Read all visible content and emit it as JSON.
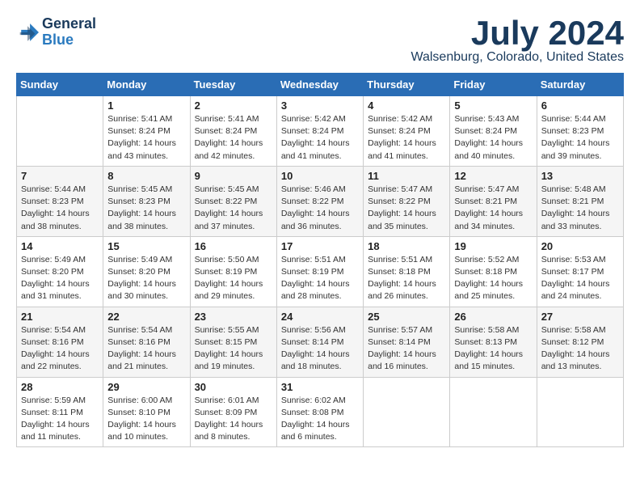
{
  "logo": {
    "line1": "General",
    "line2": "Blue"
  },
  "title": "July 2024",
  "location": "Walsenburg, Colorado, United States",
  "weekdays": [
    "Sunday",
    "Monday",
    "Tuesday",
    "Wednesday",
    "Thursday",
    "Friday",
    "Saturday"
  ],
  "weeks": [
    [
      {
        "day": null,
        "sunrise": null,
        "sunset": null,
        "daylight": null
      },
      {
        "day": "1",
        "sunrise": "Sunrise: 5:41 AM",
        "sunset": "Sunset: 8:24 PM",
        "daylight": "Daylight: 14 hours and 43 minutes."
      },
      {
        "day": "2",
        "sunrise": "Sunrise: 5:41 AM",
        "sunset": "Sunset: 8:24 PM",
        "daylight": "Daylight: 14 hours and 42 minutes."
      },
      {
        "day": "3",
        "sunrise": "Sunrise: 5:42 AM",
        "sunset": "Sunset: 8:24 PM",
        "daylight": "Daylight: 14 hours and 41 minutes."
      },
      {
        "day": "4",
        "sunrise": "Sunrise: 5:42 AM",
        "sunset": "Sunset: 8:24 PM",
        "daylight": "Daylight: 14 hours and 41 minutes."
      },
      {
        "day": "5",
        "sunrise": "Sunrise: 5:43 AM",
        "sunset": "Sunset: 8:24 PM",
        "daylight": "Daylight: 14 hours and 40 minutes."
      },
      {
        "day": "6",
        "sunrise": "Sunrise: 5:44 AM",
        "sunset": "Sunset: 8:23 PM",
        "daylight": "Daylight: 14 hours and 39 minutes."
      }
    ],
    [
      {
        "day": "7",
        "sunrise": "Sunrise: 5:44 AM",
        "sunset": "Sunset: 8:23 PM",
        "daylight": "Daylight: 14 hours and 38 minutes."
      },
      {
        "day": "8",
        "sunrise": "Sunrise: 5:45 AM",
        "sunset": "Sunset: 8:23 PM",
        "daylight": "Daylight: 14 hours and 38 minutes."
      },
      {
        "day": "9",
        "sunrise": "Sunrise: 5:45 AM",
        "sunset": "Sunset: 8:22 PM",
        "daylight": "Daylight: 14 hours and 37 minutes."
      },
      {
        "day": "10",
        "sunrise": "Sunrise: 5:46 AM",
        "sunset": "Sunset: 8:22 PM",
        "daylight": "Daylight: 14 hours and 36 minutes."
      },
      {
        "day": "11",
        "sunrise": "Sunrise: 5:47 AM",
        "sunset": "Sunset: 8:22 PM",
        "daylight": "Daylight: 14 hours and 35 minutes."
      },
      {
        "day": "12",
        "sunrise": "Sunrise: 5:47 AM",
        "sunset": "Sunset: 8:21 PM",
        "daylight": "Daylight: 14 hours and 34 minutes."
      },
      {
        "day": "13",
        "sunrise": "Sunrise: 5:48 AM",
        "sunset": "Sunset: 8:21 PM",
        "daylight": "Daylight: 14 hours and 33 minutes."
      }
    ],
    [
      {
        "day": "14",
        "sunrise": "Sunrise: 5:49 AM",
        "sunset": "Sunset: 8:20 PM",
        "daylight": "Daylight: 14 hours and 31 minutes."
      },
      {
        "day": "15",
        "sunrise": "Sunrise: 5:49 AM",
        "sunset": "Sunset: 8:20 PM",
        "daylight": "Daylight: 14 hours and 30 minutes."
      },
      {
        "day": "16",
        "sunrise": "Sunrise: 5:50 AM",
        "sunset": "Sunset: 8:19 PM",
        "daylight": "Daylight: 14 hours and 29 minutes."
      },
      {
        "day": "17",
        "sunrise": "Sunrise: 5:51 AM",
        "sunset": "Sunset: 8:19 PM",
        "daylight": "Daylight: 14 hours and 28 minutes."
      },
      {
        "day": "18",
        "sunrise": "Sunrise: 5:51 AM",
        "sunset": "Sunset: 8:18 PM",
        "daylight": "Daylight: 14 hours and 26 minutes."
      },
      {
        "day": "19",
        "sunrise": "Sunrise: 5:52 AM",
        "sunset": "Sunset: 8:18 PM",
        "daylight": "Daylight: 14 hours and 25 minutes."
      },
      {
        "day": "20",
        "sunrise": "Sunrise: 5:53 AM",
        "sunset": "Sunset: 8:17 PM",
        "daylight": "Daylight: 14 hours and 24 minutes."
      }
    ],
    [
      {
        "day": "21",
        "sunrise": "Sunrise: 5:54 AM",
        "sunset": "Sunset: 8:16 PM",
        "daylight": "Daylight: 14 hours and 22 minutes."
      },
      {
        "day": "22",
        "sunrise": "Sunrise: 5:54 AM",
        "sunset": "Sunset: 8:16 PM",
        "daylight": "Daylight: 14 hours and 21 minutes."
      },
      {
        "day": "23",
        "sunrise": "Sunrise: 5:55 AM",
        "sunset": "Sunset: 8:15 PM",
        "daylight": "Daylight: 14 hours and 19 minutes."
      },
      {
        "day": "24",
        "sunrise": "Sunrise: 5:56 AM",
        "sunset": "Sunset: 8:14 PM",
        "daylight": "Daylight: 14 hours and 18 minutes."
      },
      {
        "day": "25",
        "sunrise": "Sunrise: 5:57 AM",
        "sunset": "Sunset: 8:14 PM",
        "daylight": "Daylight: 14 hours and 16 minutes."
      },
      {
        "day": "26",
        "sunrise": "Sunrise: 5:58 AM",
        "sunset": "Sunset: 8:13 PM",
        "daylight": "Daylight: 14 hours and 15 minutes."
      },
      {
        "day": "27",
        "sunrise": "Sunrise: 5:58 AM",
        "sunset": "Sunset: 8:12 PM",
        "daylight": "Daylight: 14 hours and 13 minutes."
      }
    ],
    [
      {
        "day": "28",
        "sunrise": "Sunrise: 5:59 AM",
        "sunset": "Sunset: 8:11 PM",
        "daylight": "Daylight: 14 hours and 11 minutes."
      },
      {
        "day": "29",
        "sunrise": "Sunrise: 6:00 AM",
        "sunset": "Sunset: 8:10 PM",
        "daylight": "Daylight: 14 hours and 10 minutes."
      },
      {
        "day": "30",
        "sunrise": "Sunrise: 6:01 AM",
        "sunset": "Sunset: 8:09 PM",
        "daylight": "Daylight: 14 hours and 8 minutes."
      },
      {
        "day": "31",
        "sunrise": "Sunrise: 6:02 AM",
        "sunset": "Sunset: 8:08 PM",
        "daylight": "Daylight: 14 hours and 6 minutes."
      },
      {
        "day": null,
        "sunrise": null,
        "sunset": null,
        "daylight": null
      },
      {
        "day": null,
        "sunrise": null,
        "sunset": null,
        "daylight": null
      },
      {
        "day": null,
        "sunrise": null,
        "sunset": null,
        "daylight": null
      }
    ]
  ]
}
